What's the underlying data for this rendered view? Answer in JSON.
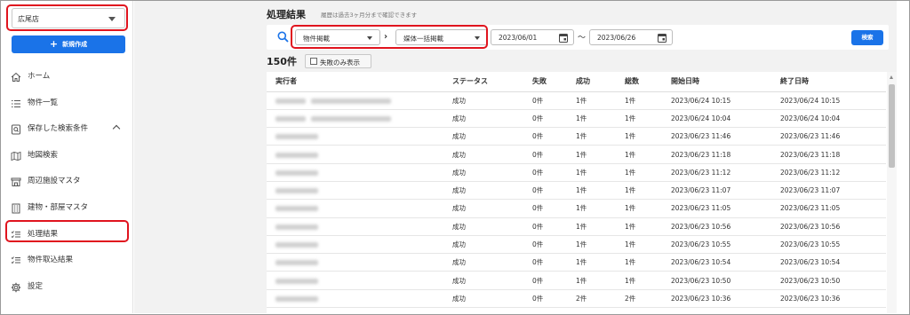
{
  "sidebar": {
    "store": "広尾店",
    "new_button": "新規作成",
    "items": [
      {
        "label": "ホーム",
        "icon": "home-icon"
      },
      {
        "label": "物件一覧",
        "icon": "list-icon"
      },
      {
        "label": "保存した検索条件",
        "icon": "saved-search-icon"
      },
      {
        "label": "地図検索",
        "icon": "map-icon"
      },
      {
        "label": "周辺施設マスタ",
        "icon": "store-icon"
      },
      {
        "label": "建物・部屋マスタ",
        "icon": "building-icon"
      },
      {
        "label": "処理結果",
        "icon": "checklist-icon"
      },
      {
        "label": "物件取込結果",
        "icon": "checklist-icon"
      },
      {
        "label": "設定",
        "icon": "gear-icon"
      }
    ]
  },
  "main": {
    "title": "処理結果",
    "subtitle": "履歴は過去3ヶ月分まで確認できます",
    "filters": {
      "type1": "物件掲載",
      "type2": "媒体一括掲載",
      "date_from": "2023/06/01",
      "date_to": "2023/06/26",
      "search_button": "検索"
    },
    "count": "150件",
    "failed_only_label": "失敗のみ表示",
    "table": {
      "headers": [
        "実行者",
        "ステータス",
        "失敗",
        "成功",
        "総数",
        "開始日時",
        "終了日時"
      ],
      "rows": [
        {
          "status": "成功",
          "fail": "0件",
          "success": "1件",
          "total": "1件",
          "start": "2023/06/24 10:15",
          "end": "2023/06/24 10:15"
        },
        {
          "status": "成功",
          "fail": "0件",
          "success": "1件",
          "total": "1件",
          "start": "2023/06/24 10:04",
          "end": "2023/06/24 10:04"
        },
        {
          "status": "成功",
          "fail": "0件",
          "success": "1件",
          "total": "1件",
          "start": "2023/06/23 11:46",
          "end": "2023/06/23 11:46"
        },
        {
          "status": "成功",
          "fail": "0件",
          "success": "1件",
          "total": "1件",
          "start": "2023/06/23 11:18",
          "end": "2023/06/23 11:18"
        },
        {
          "status": "成功",
          "fail": "0件",
          "success": "1件",
          "total": "1件",
          "start": "2023/06/23 11:12",
          "end": "2023/06/23 11:12"
        },
        {
          "status": "成功",
          "fail": "0件",
          "success": "1件",
          "total": "1件",
          "start": "2023/06/23 11:07",
          "end": "2023/06/23 11:07"
        },
        {
          "status": "成功",
          "fail": "0件",
          "success": "1件",
          "total": "1件",
          "start": "2023/06/23 11:05",
          "end": "2023/06/23 11:05"
        },
        {
          "status": "成功",
          "fail": "0件",
          "success": "1件",
          "total": "1件",
          "start": "2023/06/23 10:56",
          "end": "2023/06/23 10:56"
        },
        {
          "status": "成功",
          "fail": "0件",
          "success": "1件",
          "total": "1件",
          "start": "2023/06/23 10:55",
          "end": "2023/06/23 10:55"
        },
        {
          "status": "成功",
          "fail": "0件",
          "success": "1件",
          "total": "1件",
          "start": "2023/06/23 10:54",
          "end": "2023/06/23 10:54"
        },
        {
          "status": "成功",
          "fail": "0件",
          "success": "1件",
          "total": "1件",
          "start": "2023/06/23 10:50",
          "end": "2023/06/23 10:50"
        },
        {
          "status": "成功",
          "fail": "0件",
          "success": "2件",
          "total": "2件",
          "start": "2023/06/23 10:36",
          "end": "2023/06/23 10:36"
        }
      ]
    }
  },
  "colors": {
    "accent": "#1a73e8",
    "highlight": "#e0141e",
    "background": "#f2f2f2"
  }
}
